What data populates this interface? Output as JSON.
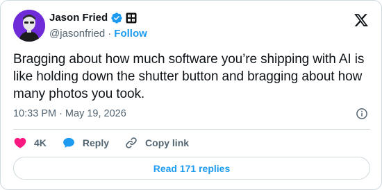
{
  "author": {
    "display_name": "Jason Fried",
    "handle": "@jasonfried",
    "separator": "·",
    "follow_label": "Follow"
  },
  "tweet": {
    "text": "Bragging about how much software you’re shipping with AI is like holding down the shutter button and bragging about how many photos you took."
  },
  "meta": {
    "time": "10:33 PM",
    "separator": "·",
    "date": "May 19, 2026"
  },
  "actions": {
    "like_count": "4K",
    "reply_label": "Reply",
    "copy_link_label": "Copy link"
  },
  "read_replies_label": "Read 171 replies",
  "icons": {
    "avatar": "avatar-photo",
    "verified": "verified-badge-icon",
    "affiliation": "affiliate-badge-icon",
    "brand": "x-logo-icon",
    "info": "info-icon",
    "like": "heart-icon",
    "reply": "speech-bubble-icon",
    "copy": "link-icon"
  },
  "colors": {
    "accent": "#1d9bf0",
    "like": "#f91880",
    "text": "#0f1419",
    "muted": "#536471",
    "border": "#cfd9de",
    "avatar_bg": "#6f2bd8"
  }
}
